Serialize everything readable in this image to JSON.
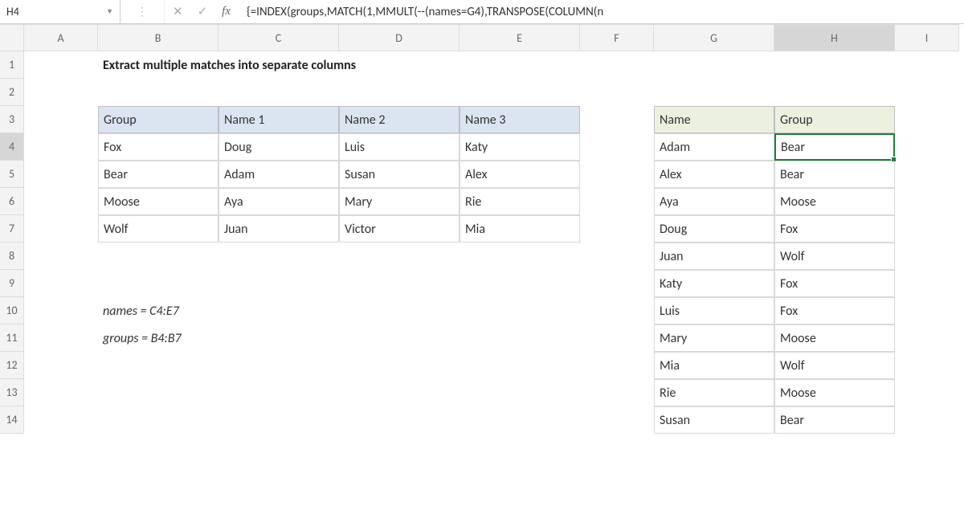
{
  "nameBox": "H4",
  "formula": "{=INDEX(groups,MATCH(1,MMULT(--(names=G4),TRANSPOSE(COLUMN(n",
  "columns": [
    "A",
    "B",
    "C",
    "D",
    "E",
    "F",
    "G",
    "H",
    "I"
  ],
  "rows": [
    "1",
    "2",
    "3",
    "4",
    "5",
    "6",
    "7",
    "8",
    "9",
    "10",
    "11",
    "12",
    "13",
    "14"
  ],
  "selectedColumn": "H",
  "selectedRow": "4",
  "title": "Extract multiple matches into separate columns",
  "left": {
    "headers": [
      "Group",
      "Name 1",
      "Name 2",
      "Name 3"
    ],
    "rows": [
      [
        "Fox",
        "Doug",
        "Luis",
        "Katy"
      ],
      [
        "Bear",
        "Adam",
        "Susan",
        "Alex"
      ],
      [
        "Moose",
        "Aya",
        "Mary",
        "Rie"
      ],
      [
        "Wolf",
        "Juan",
        "Victor",
        "Mia"
      ]
    ]
  },
  "right": {
    "headers": [
      "Name",
      "Group"
    ],
    "rows": [
      [
        "Adam",
        "Bear"
      ],
      [
        "Alex",
        "Bear"
      ],
      [
        "Aya",
        "Moose"
      ],
      [
        "Doug",
        "Fox"
      ],
      [
        "Juan",
        "Wolf"
      ],
      [
        "Katy",
        "Fox"
      ],
      [
        "Luis",
        "Fox"
      ],
      [
        "Mary",
        "Moose"
      ],
      [
        "Mia",
        "Wolf"
      ],
      [
        "Rie",
        "Moose"
      ],
      [
        "Susan",
        "Bear"
      ]
    ]
  },
  "notes": {
    "namesDef": "names = C4:E7",
    "groupsDef": "groups = B4:B7"
  },
  "icons": {
    "cancel": "✕",
    "enter": "✓",
    "fx": "fx",
    "sep": "⋮"
  }
}
